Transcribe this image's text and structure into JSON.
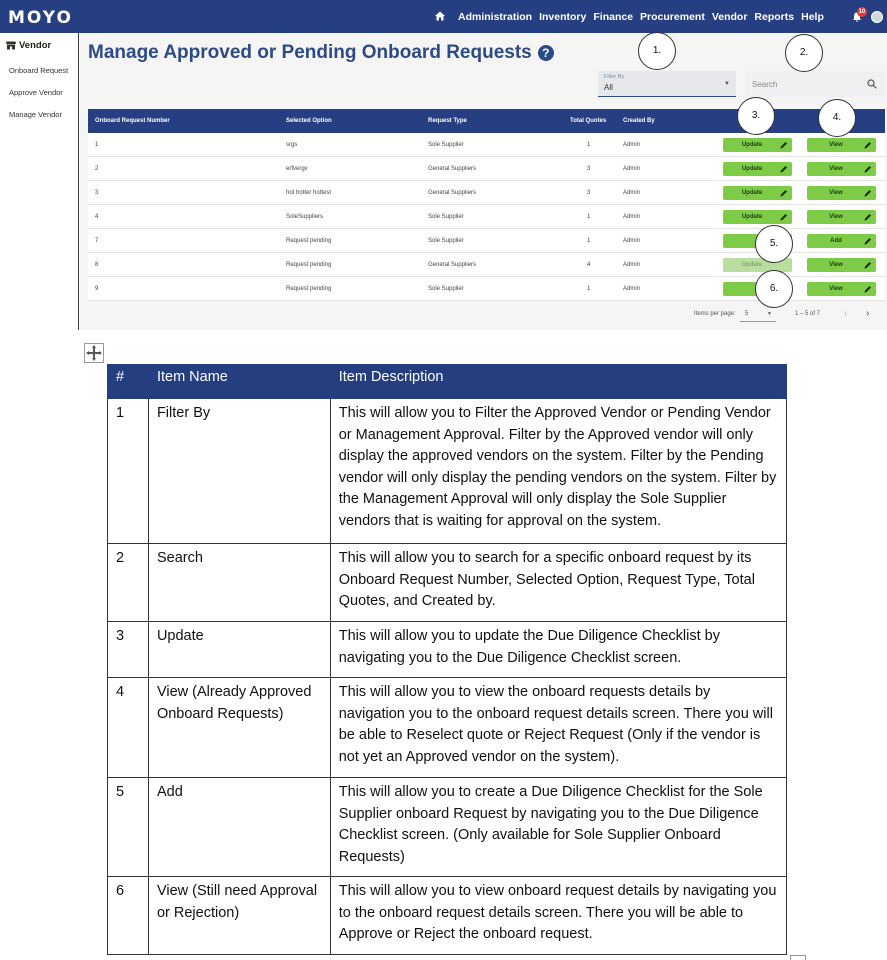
{
  "app": {
    "logo": "MOYO",
    "nav": [
      "Administration",
      "Inventory",
      "Finance",
      "Procurement",
      "Vendor",
      "Reports",
      "Help"
    ],
    "notification_count": "10"
  },
  "sidebar": {
    "title": "Vendor",
    "items": [
      "Onboard Request",
      "Approve Vendor",
      "Manage Vendor"
    ]
  },
  "page": {
    "title": "Manage Approved or Pending Onboard Requests",
    "filter": {
      "label": "Filter By",
      "value": "All"
    },
    "search": {
      "placeholder": "Search"
    }
  },
  "grid": {
    "columns": [
      "Onboard Request Number",
      "Selected Option",
      "Request Type",
      "Total Quotes",
      "Created By"
    ],
    "rows": [
      {
        "number": "1",
        "option": "srgs",
        "type": "Sole Supplier",
        "quotes": "1",
        "created_by": "Admin",
        "left_btn": "Update",
        "right_btn": "View"
      },
      {
        "number": "2",
        "option": "erfvergv",
        "type": "General Suppliers",
        "quotes": "3",
        "created_by": "Admin",
        "left_btn": "Update",
        "right_btn": "View"
      },
      {
        "number": "3",
        "option": "hot hotter hottest",
        "type": "General Suppliers",
        "quotes": "3",
        "created_by": "Admin",
        "left_btn": "Update",
        "right_btn": "View"
      },
      {
        "number": "4",
        "option": "SoleSuppliers",
        "type": "Sole Supplier",
        "quotes": "1",
        "created_by": "Admin",
        "left_btn": "Update",
        "right_btn": "View"
      },
      {
        "number": "7",
        "option": "Request pending",
        "type": "Sole Supplier",
        "quotes": "1",
        "created_by": "Admin",
        "left_btn": "",
        "right_btn": "Add"
      },
      {
        "number": "8",
        "option": "Request pending",
        "type": "General Suppliers",
        "quotes": "4",
        "created_by": "Admin",
        "left_btn": "Update",
        "right_btn": "View"
      },
      {
        "number": "9",
        "option": "Request pending",
        "type": "Sole Supplier",
        "quotes": "1",
        "created_by": "Admin",
        "left_btn": "",
        "right_btn": "View"
      }
    ],
    "pager": {
      "items_label": "Items per page:",
      "page_size": "5",
      "range": "1 – 5 of 7"
    }
  },
  "callouts": [
    "1.",
    "2.",
    "3.",
    "4.",
    "5.",
    "6."
  ],
  "table": {
    "headers": [
      "#",
      "Item Name",
      "Item Description"
    ],
    "rows": [
      {
        "num": "1",
        "name": "Filter By",
        "desc": "This will allow you to Filter the Approved Vendor or Pending Vendor or Management Approval. Filter by the Approved vendor will only display the approved vendors on the system. Filter by the Pending vendor will only display the pending vendors on the system. Filter by the Management Approval will only display the Sole Supplier vendors that is waiting for approval on the system."
      },
      {
        "num": "2",
        "name": "Search",
        "desc": "This will allow you to search for a specific onboard request by its Onboard Request Number, Selected Option, Request Type, Total Quotes, and Created by."
      },
      {
        "num": "3",
        "name": "Update",
        "desc": "This will allow you to update the Due Diligence Checklist by navigating you to the Due Diligence Checklist screen."
      },
      {
        "num": "4",
        "name": "View (Already Approved Onboard Requests)",
        "desc": "This will allow you to view the onboard requests details by navigation you to the onboard request details screen. There you will be able to Reselect quote or Reject Request (Only if the vendor is not yet an Approved vendor on the system)."
      },
      {
        "num": "5",
        "name": "Add",
        "desc": "This will allow you to create a Due Diligence Checklist for the Sole Supplier onboard Request by navigating you to the Due Diligence Checklist screen. (Only available for Sole Supplier Onboard Requests)"
      },
      {
        "num": "6",
        "name": "View (Still need Approval or Rejection)",
        "desc": "This will allow you to view onboard request details by navigating you to the onboard request details screen. There you will be able to Approve or Reject the onboard request."
      }
    ]
  }
}
